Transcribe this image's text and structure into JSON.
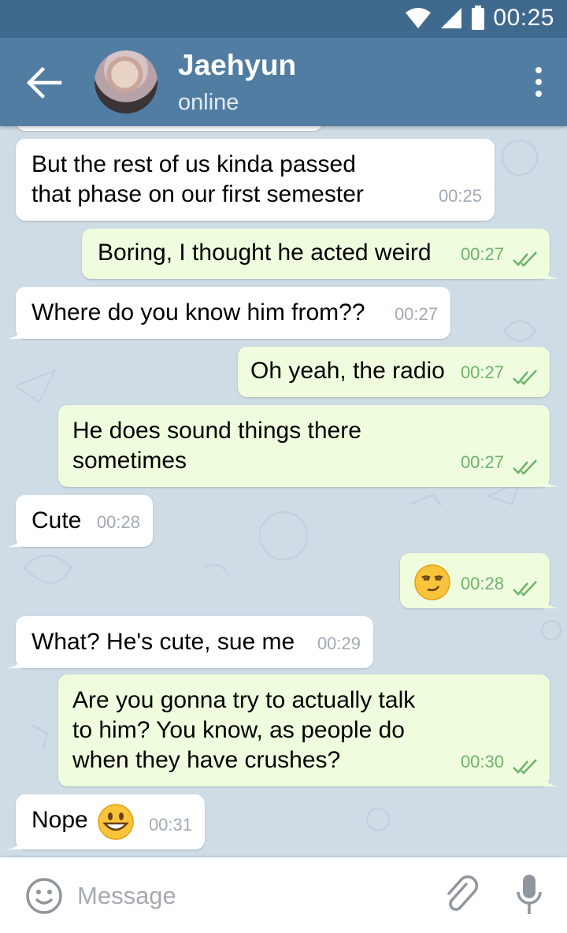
{
  "status_bar": {
    "time": "00:25"
  },
  "header": {
    "back_icon": "arrow-left-icon",
    "contact_name": "Jaehyun",
    "contact_status": "online",
    "menu_icon": "more-vertical-icon"
  },
  "messages": [
    {
      "direction": "in",
      "text": "But the rest of us kinda passed\nthat phase on our first semester",
      "time": "00:25"
    },
    {
      "direction": "out",
      "text": "Boring, I thought he acted weird",
      "time": "00:27",
      "status_icon": "double-check-icon"
    },
    {
      "direction": "in",
      "text": "Where do you know him from??",
      "time": "00:27"
    },
    {
      "direction": "out",
      "text": "Oh yeah, the radio",
      "time": "00:27",
      "status_icon": "double-check-icon"
    },
    {
      "direction": "out",
      "text": "He does sound things there\nsometimes",
      "time": "00:27",
      "status_icon": "double-check-icon"
    },
    {
      "direction": "in",
      "text": "Cute",
      "time": "00:28"
    },
    {
      "direction": "out",
      "text": "",
      "emoji_icon": "smirk-emoji-icon",
      "time": "00:28",
      "status_icon": "double-check-icon"
    },
    {
      "direction": "in",
      "text": "What? He's cute, sue me",
      "time": "00:29"
    },
    {
      "direction": "out",
      "text": "Are you gonna try to actually talk\nto him? You know, as people do\nwhen they have crushes?",
      "time": "00:30",
      "status_icon": "double-check-icon"
    },
    {
      "direction": "in",
      "text": "Nope",
      "emoji_icon": "grinning-emoji-icon",
      "time": "00:31"
    }
  ],
  "input_bar": {
    "placeholder": "Message",
    "emoji_icon": "smiley-icon",
    "attach_icon": "paperclip-icon",
    "mic_icon": "microphone-icon"
  },
  "colors": {
    "status_bar": "#3f6a8e",
    "header": "#527da3",
    "chat_background": "#cfdce6",
    "incoming_bubble": "#ffffff",
    "outgoing_bubble": "#effdde",
    "outgoing_time": "#6fb26b"
  }
}
